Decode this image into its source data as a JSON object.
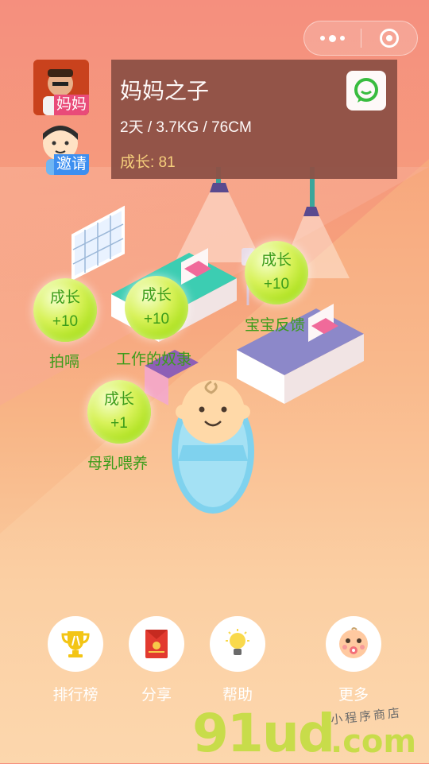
{
  "header": {
    "menu_icon": "more-dots-icon",
    "close_icon": "target-close-icon"
  },
  "avatars": {
    "mom_tag": "妈妈",
    "invite_tag": "邀请"
  },
  "info": {
    "name": "妈妈之子",
    "stats": "2天 / 3.7KG / 76CM",
    "growth": "成长: 81",
    "chat_icon": "chat-bubble-icon"
  },
  "bubbles": [
    {
      "title": "成长",
      "value": "+10",
      "label": "拍嗝"
    },
    {
      "title": "成长",
      "value": "+10",
      "label": "工作的奴隶"
    },
    {
      "title": "成长",
      "value": "+10",
      "label": "宝宝反馈"
    },
    {
      "title": "成长",
      "value": "+1",
      "label": "母乳喂养"
    }
  ],
  "nav": [
    {
      "label": "排行榜",
      "icon": "trophy-icon"
    },
    {
      "label": "分享",
      "icon": "red-envelope-icon"
    },
    {
      "label": "帮助",
      "icon": "lightbulb-icon"
    },
    {
      "label": "更多",
      "icon": "baby-face-icon"
    }
  ],
  "watermark": {
    "main": "91ud",
    "domain": ".com",
    "sub": "小程序商店"
  },
  "colors": {
    "accent_green": "#3b9c1a",
    "card_bg": "#8e5146",
    "growth_gold": "#f7d27c"
  }
}
